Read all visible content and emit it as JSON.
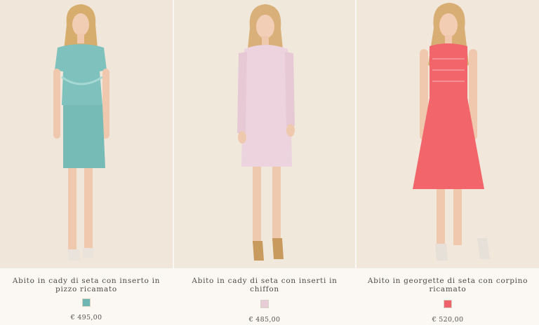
{
  "products": [
    {
      "title": "Abito in cady di seta con inserto in pizzo ricamato",
      "swatch_color": "#6fb6b3",
      "price": "€ 495,00",
      "dress_color": "#7fc2bd",
      "image": "model-in-aqua-lace-dress-image"
    },
    {
      "title": "Abito in cady di seta con inserti in chiffon",
      "swatch_color": "#e8ccd6",
      "price": "€ 485,00",
      "dress_color": "#ecd3de",
      "image": "model-in-pale-pink-dress-image"
    },
    {
      "title": "Abito in georgette di seta con corpino ricamato",
      "swatch_color": "#f0626a",
      "price": "€ 520,00",
      "dress_color": "#f2656b",
      "image": "model-in-coral-dress-image"
    }
  ]
}
